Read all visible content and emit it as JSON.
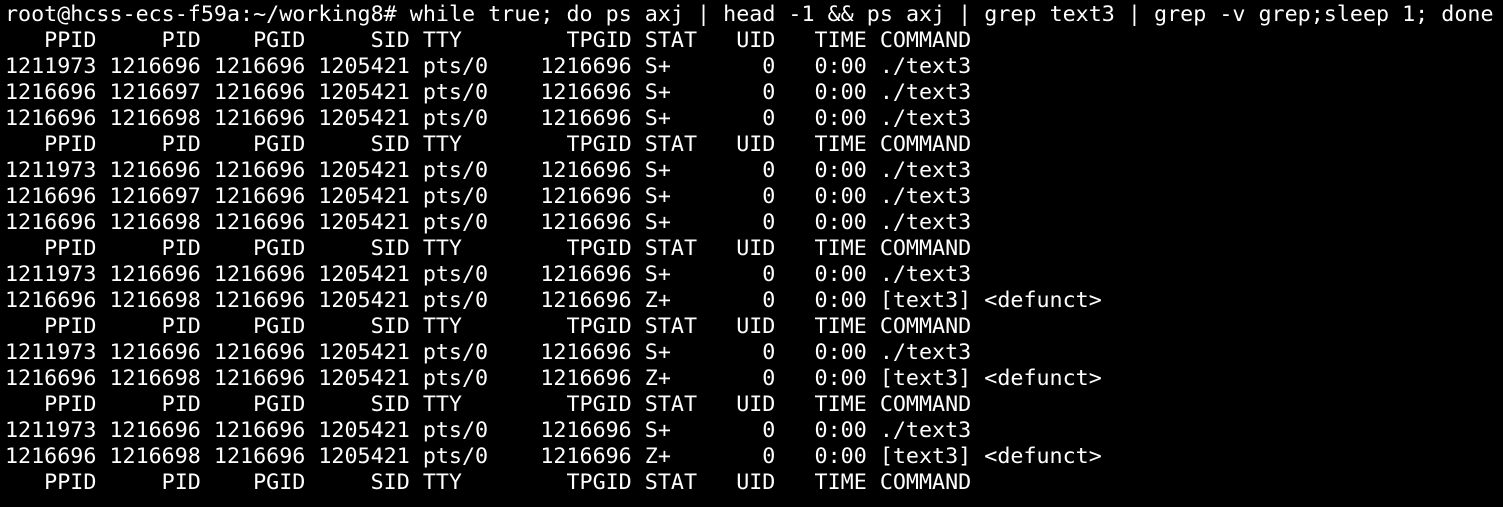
{
  "terminal": {
    "prompt": "root@hcss-ecs-f59a:~/working8#",
    "command": "while true; do ps axj | head -1 && ps axj | grep text3 | grep -v grep;sleep 1; done",
    "lines": [
      "   PPID     PID    PGID     SID TTY        TPGID STAT   UID   TIME COMMAND",
      "1211973 1216696 1216696 1205421 pts/0    1216696 S+       0   0:00 ./text3",
      "1216696 1216697 1216696 1205421 pts/0    1216696 S+       0   0:00 ./text3",
      "1216696 1216698 1216696 1205421 pts/0    1216696 S+       0   0:00 ./text3",
      "   PPID     PID    PGID     SID TTY        TPGID STAT   UID   TIME COMMAND",
      "1211973 1216696 1216696 1205421 pts/0    1216696 S+       0   0:00 ./text3",
      "1216696 1216697 1216696 1205421 pts/0    1216696 S+       0   0:00 ./text3",
      "1216696 1216698 1216696 1205421 pts/0    1216696 S+       0   0:00 ./text3",
      "   PPID     PID    PGID     SID TTY        TPGID STAT   UID   TIME COMMAND",
      "1211973 1216696 1216696 1205421 pts/0    1216696 S+       0   0:00 ./text3",
      "1216696 1216698 1216696 1205421 pts/0    1216696 Z+       0   0:00 [text3] <defunct>",
      "   PPID     PID    PGID     SID TTY        TPGID STAT   UID   TIME COMMAND",
      "1211973 1216696 1216696 1205421 pts/0    1216696 S+       0   0:00 ./text3",
      "1216696 1216698 1216696 1205421 pts/0    1216696 Z+       0   0:00 [text3] <defunct>",
      "   PPID     PID    PGID     SID TTY        TPGID STAT   UID   TIME COMMAND",
      "1211973 1216696 1216696 1205421 pts/0    1216696 S+       0   0:00 ./text3",
      "1216696 1216698 1216696 1205421 pts/0    1216696 Z+       0   0:00 [text3] <defunct>",
      "   PPID     PID    PGID     SID TTY        TPGID STAT   UID   TIME COMMAND"
    ]
  }
}
